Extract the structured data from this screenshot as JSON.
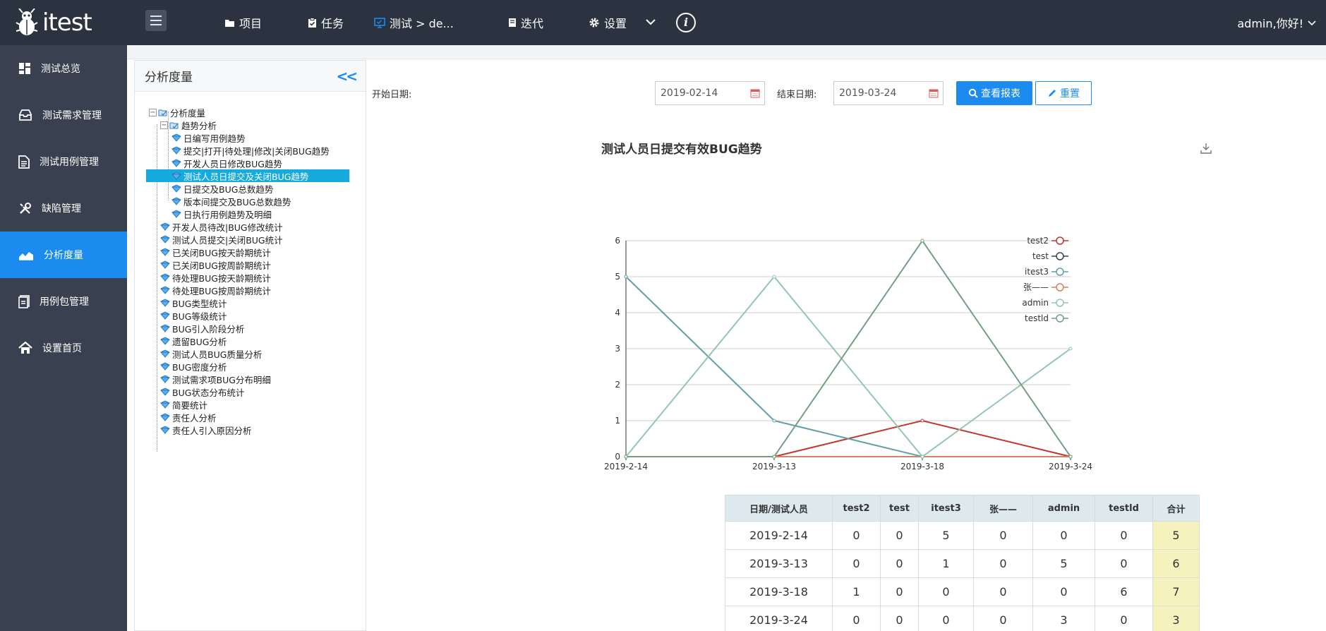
{
  "app": {
    "name": "itest"
  },
  "topnav": {
    "items": [
      {
        "label": "项目",
        "icon": "folder-icon"
      },
      {
        "label": "任务",
        "icon": "clipboard-check-icon"
      },
      {
        "label": "测试 > de...",
        "icon": "monitor-icon"
      },
      {
        "label": "迭代",
        "icon": "book-icon"
      },
      {
        "label": "设置",
        "icon": "gear-icon"
      }
    ],
    "user_greeting": "admin,你好!"
  },
  "sidebar": {
    "items": [
      {
        "label": "测试总览",
        "icon": "dashboard-icon",
        "active": false
      },
      {
        "label": "测试需求管理",
        "icon": "inbox-icon",
        "active": false
      },
      {
        "label": "测试用例管理",
        "icon": "document-icon",
        "active": false
      },
      {
        "label": "缺陷管理",
        "icon": "tools-icon",
        "active": false
      },
      {
        "label": "分析度量",
        "icon": "area-chart-icon",
        "active": true
      },
      {
        "label": "用例包管理",
        "icon": "package-icon",
        "active": false
      },
      {
        "label": "设置首页",
        "icon": "home-icon",
        "active": false
      }
    ]
  },
  "tree_panel": {
    "title": "分析度量",
    "root": "分析度量",
    "group": "趋势分析",
    "group_children": [
      "日编写用例趋势",
      "提交|打开|待处理|修改|关闭BUG趋势",
      "开发人员日修改BUG趋势",
      "测试人员日提交及关闭BUG趋势",
      "日提交及BUG总数趋势",
      "版本间提交及BUG总数趋势",
      "日执行用例趋势及明细"
    ],
    "selected": "测试人员日提交及关闭BUG趋势",
    "items": [
      "开发人员待改|BUG修改统计",
      "测试人员提交|关闭BUG统计",
      "已关闭BUG按天龄期统计",
      "已关闭BUG按周龄期统计",
      "待处理BUG按天龄期统计",
      "待处理BUG按周龄期统计",
      "BUG类型统计",
      "BUG等级统计",
      "BUG引入阶段分析",
      "遗留BUG分析",
      "测试人员BUG质量分析",
      "BUG密度分析",
      "测试需求项BUG分布明细",
      "BUG状态分布统计",
      "简要统计",
      "责任人分析",
      "责任人引入原因分析"
    ]
  },
  "filter": {
    "start_label": "开始日期:",
    "start_value": "2019-02-14",
    "end_label": "结束日期:",
    "end_value": "2019-03-24",
    "query_button": "查看报表",
    "reset_button": "重置"
  },
  "colors": {
    "accent": "#1b8bf0",
    "topbar": "#2b3240",
    "sidebar": "#39404f",
    "tree_selected": "#17aadd",
    "total_cell": "#f5f2bd"
  },
  "chart_data": {
    "type": "line",
    "title": "测试人员日提交有效BUG趋势",
    "categories": [
      "2019-2-14",
      "2019-3-13",
      "2019-3-18",
      "2019-3-24"
    ],
    "ylim": [
      0,
      6
    ],
    "yticks": [
      0,
      1,
      2,
      3,
      4,
      5,
      6
    ],
    "grid": true,
    "legend_position": "top-right",
    "series": [
      {
        "name": "test2",
        "values": [
          0,
          0,
          1,
          0
        ],
        "color": "#c23531"
      },
      {
        "name": "test",
        "values": [
          0,
          0,
          0,
          0
        ],
        "color": "#2f4554"
      },
      {
        "name": "itest3",
        "values": [
          5,
          1,
          0,
          0
        ],
        "color": "#61a0a8"
      },
      {
        "name": "张——",
        "values": [
          0,
          0,
          0,
          0
        ],
        "color": "#d48265"
      },
      {
        "name": "admin",
        "values": [
          0,
          5,
          0,
          3
        ],
        "color": "#91c7ae"
      },
      {
        "name": "testld",
        "values": [
          0,
          0,
          6,
          0
        ],
        "color": "#749f83"
      }
    ]
  },
  "table": {
    "headers": [
      "日期/测试人员",
      "test2",
      "test",
      "itest3",
      "张——",
      "admin",
      "testld",
      "合计"
    ],
    "rows": [
      [
        "2019-2-14",
        "0",
        "0",
        "5",
        "0",
        "0",
        "0",
        "5"
      ],
      [
        "2019-3-13",
        "0",
        "0",
        "1",
        "0",
        "5",
        "0",
        "6"
      ],
      [
        "2019-3-18",
        "1",
        "0",
        "0",
        "0",
        "0",
        "6",
        "7"
      ],
      [
        "2019-3-24",
        "0",
        "0",
        "0",
        "0",
        "3",
        "0",
        "3"
      ]
    ]
  }
}
